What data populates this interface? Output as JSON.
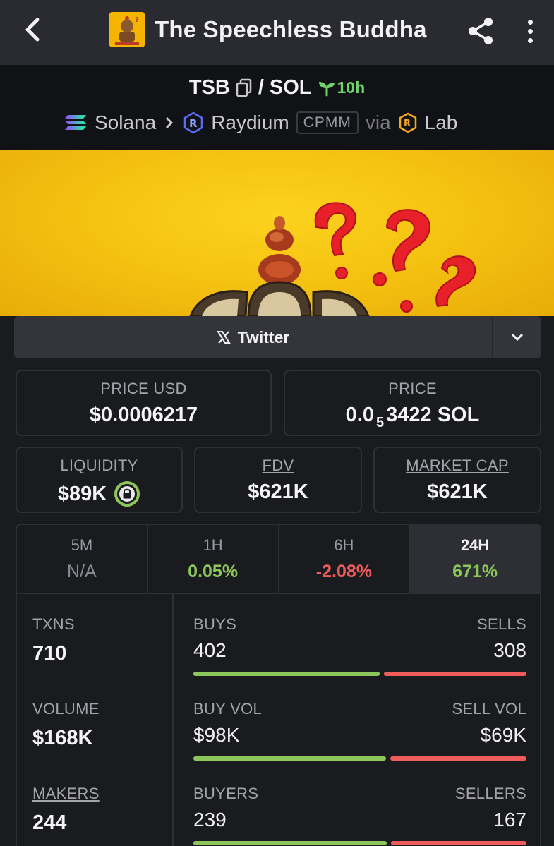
{
  "header": {
    "title": "The Speechless Buddha",
    "back_icon": "chevron-left-icon",
    "share_icon": "share-icon",
    "more_icon": "more-vertical-icon"
  },
  "pair": {
    "base": "TSB",
    "separator": "/",
    "quote": "SOL",
    "age": "10h",
    "chain": "Solana",
    "dex": "Raydium",
    "pool_type": "CPMM",
    "via": "via",
    "launchpad": "Lab"
  },
  "socials": {
    "twitter_label": "Twitter"
  },
  "stats": {
    "price_usd_label": "PRICE USD",
    "price_usd": "$0.0006217",
    "price_label": "PRICE",
    "price_prefix": "0.0",
    "price_subscript": "5",
    "price_suffix": "3422 SOL",
    "liquidity_label": "LIQUIDITY",
    "liquidity": "$89K",
    "fdv_label": "FDV",
    "fdv": "$621K",
    "mcap_label": "MARKET CAP",
    "mcap": "$621K"
  },
  "timeframes": [
    {
      "label": "5M",
      "value": "N/A",
      "kind": "na"
    },
    {
      "label": "1H",
      "value": "0.05%",
      "kind": "pos"
    },
    {
      "label": "6H",
      "value": "-2.08%",
      "kind": "neg"
    },
    {
      "label": "24H",
      "value": "671%",
      "kind": "pos"
    }
  ],
  "metrics": {
    "txns_label": "TXNS",
    "txns": "710",
    "volume_label": "VOLUME",
    "volume": "$168K",
    "makers_label": "MAKERS",
    "makers": "244",
    "buys_label": "BUYS",
    "buys": "402",
    "sells_label": "SELLS",
    "sells": "308",
    "buy_vol_label": "BUY VOL",
    "buy_vol": "$98K",
    "sell_vol_label": "SELL VOL",
    "sell_vol": "$69K",
    "buyers_label": "BUYERS",
    "buyers": "239",
    "sellers_label": "SELLERS",
    "sellers": "167"
  },
  "colors": {
    "positive": "#8dc65a",
    "negative": "#ef5b5b",
    "age_green": "#6fd36b",
    "banner_yellow": "#f5c311"
  }
}
